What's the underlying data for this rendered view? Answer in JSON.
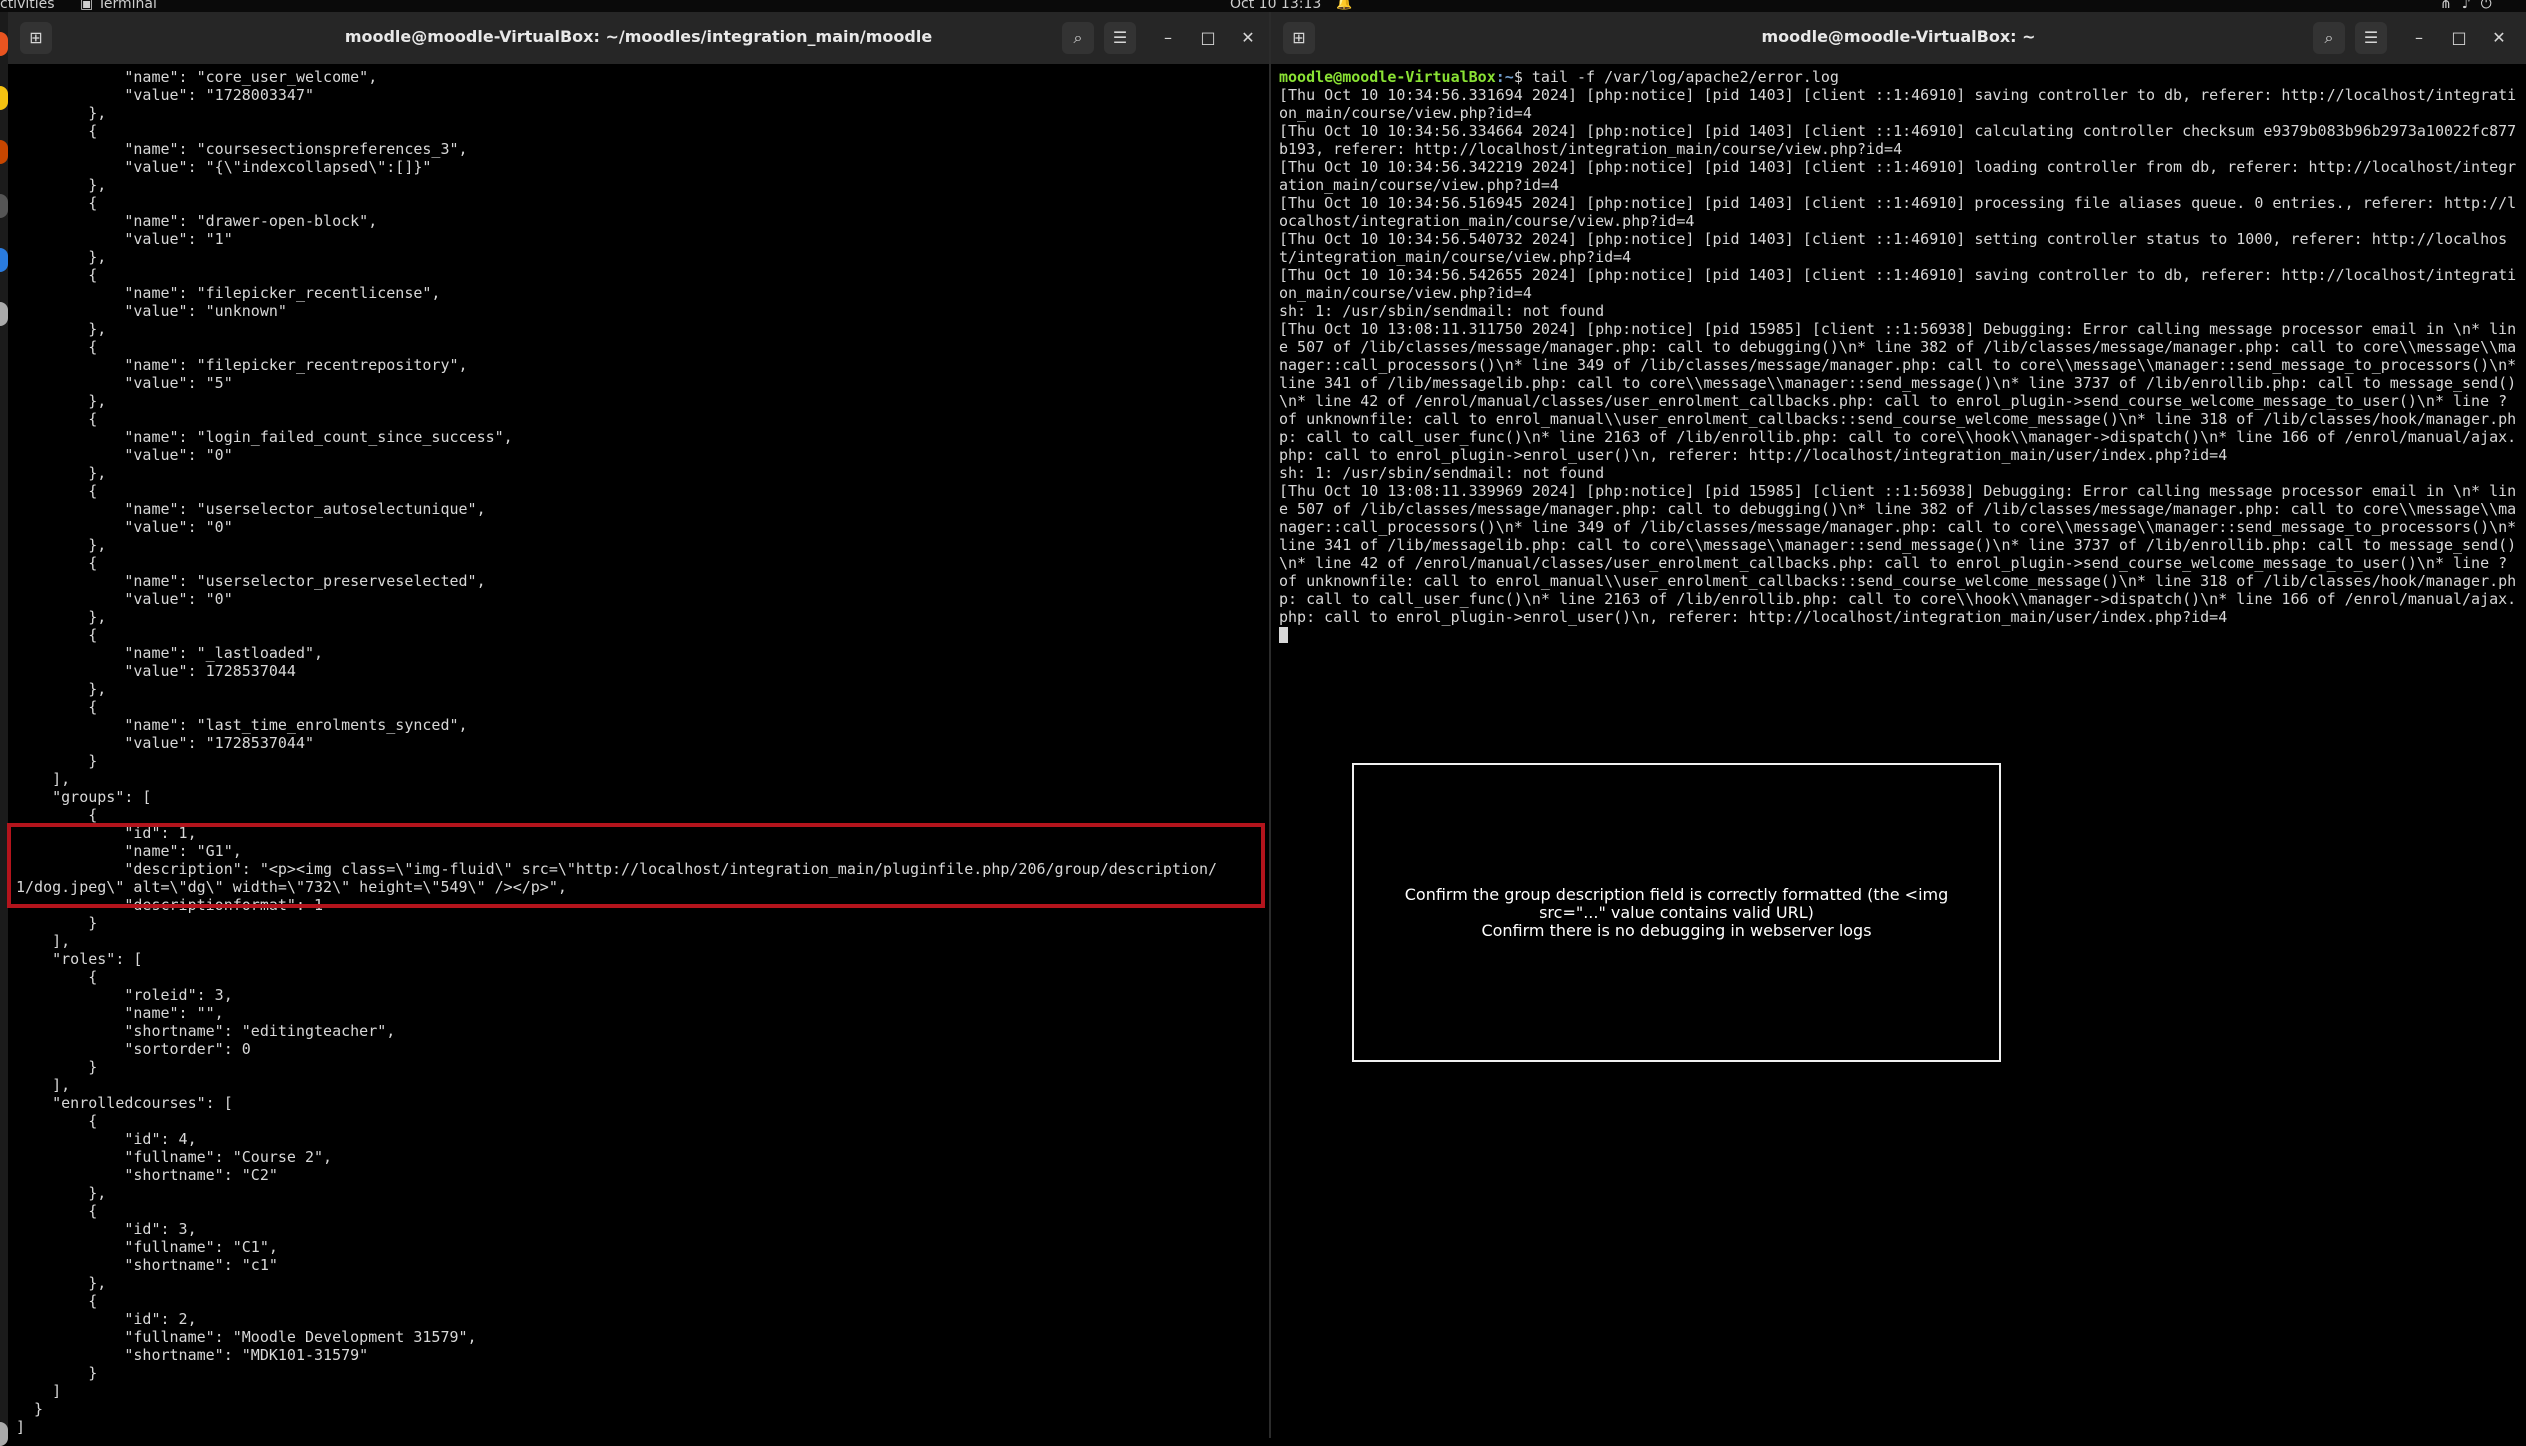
{
  "topbar": {
    "activities": "ctivities",
    "app_name": "Terminal",
    "clock": "Oct 10  13:13",
    "bell_icon": "bell-icon",
    "tray_icons": [
      "network-icon",
      "volume-icon",
      "power-icon"
    ]
  },
  "left_terminal": {
    "title": "moodle@moodle-VirtualBox: ~/moodles/integration_main/moodle",
    "lines": [
      "            \"name\": \"core_user_welcome\",",
      "            \"value\": \"1728003347\"",
      "        },",
      "        {",
      "            \"name\": \"coursesectionspreferences_3\",",
      "            \"value\": \"{\\\"indexcollapsed\\\":[]}\"",
      "        },",
      "        {",
      "            \"name\": \"drawer-open-block\",",
      "            \"value\": \"1\"",
      "        },",
      "        {",
      "            \"name\": \"filepicker_recentlicense\",",
      "            \"value\": \"unknown\"",
      "        },",
      "        {",
      "            \"name\": \"filepicker_recentrepository\",",
      "            \"value\": \"5\"",
      "        },",
      "        {",
      "            \"name\": \"login_failed_count_since_success\",",
      "            \"value\": \"0\"",
      "        },",
      "        {",
      "            \"name\": \"userselector_autoselectunique\",",
      "            \"value\": \"0\"",
      "        },",
      "        {",
      "            \"name\": \"userselector_preserveselected\",",
      "            \"value\": \"0\"",
      "        },",
      "        {",
      "            \"name\": \"_lastloaded\",",
      "            \"value\": 1728537044",
      "        },",
      "        {",
      "            \"name\": \"last_time_enrolments_synced\",",
      "            \"value\": \"1728537044\"",
      "        }",
      "    ],",
      "    \"groups\": [",
      "        {",
      "            \"id\": 1,",
      "            \"name\": \"G1\",",
      "            \"description\": \"<p><img class=\\\"img-fluid\\\" src=\\\"http://localhost/integration_main/pluginfile.php/206/group/description/",
      "1/dog.jpeg\\\" alt=\\\"dg\\\" width=\\\"732\\\" height=\\\"549\\\" /></p>\",",
      "            \"descriptionformat\": 1",
      "        }",
      "    ],",
      "    \"roles\": [",
      "        {",
      "            \"roleid\": 3,",
      "            \"name\": \"\",",
      "            \"shortname\": \"editingteacher\",",
      "            \"sortorder\": 0",
      "        }",
      "    ],",
      "    \"enrolledcourses\": [",
      "        {",
      "            \"id\": 4,",
      "            \"fullname\": \"Course 2\",",
      "            \"shortname\": \"C2\"",
      "        },",
      "        {",
      "            \"id\": 3,",
      "            \"fullname\": \"C1\",",
      "            \"shortname\": \"c1\"",
      "        },",
      "        {",
      "            \"id\": 2,",
      "            \"fullname\": \"Moodle Development 31579\",",
      "            \"shortname\": \"MDK101-31579\"",
      "        }",
      "    ]",
      "  }",
      "]"
    ],
    "highlight_label": "highlighted group description"
  },
  "right_terminal": {
    "title": "moodle@moodle-VirtualBox: ~",
    "prompt_user": "moodle@moodle-VirtualBox",
    "prompt_path": ":~",
    "prompt_symbol": "$",
    "command": " tail -f /var/log/apache2/error.log",
    "log_lines": [
      "[Thu Oct 10 10:34:56.331694 2024] [php:notice] [pid 1403] [client ::1:46910] saving controller to db, referer: http://localhost/integration_main/course/view.php?id=4",
      "[Thu Oct 10 10:34:56.334664 2024] [php:notice] [pid 1403] [client ::1:46910] calculating controller checksum e9379b083b96b2973a10022fc877b193, referer: http://localhost/integration_main/course/view.php?id=4",
      "[Thu Oct 10 10:34:56.342219 2024] [php:notice] [pid 1403] [client ::1:46910] loading controller from db, referer: http://localhost/integration_main/course/view.php?id=4",
      "[Thu Oct 10 10:34:56.516945 2024] [php:notice] [pid 1403] [client ::1:46910] processing file aliases queue. 0 entries., referer: http://localhost/integration_main/course/view.php?id=4",
      "[Thu Oct 10 10:34:56.540732 2024] [php:notice] [pid 1403] [client ::1:46910] setting controller status to 1000, referer: http://localhost/integration_main/course/view.php?id=4",
      "[Thu Oct 10 10:34:56.542655 2024] [php:notice] [pid 1403] [client ::1:46910] saving controller to db, referer: http://localhost/integration_main/course/view.php?id=4",
      "sh: 1: /usr/sbin/sendmail: not found",
      "[Thu Oct 10 13:08:11.311750 2024] [php:notice] [pid 15985] [client ::1:56938] Debugging: Error calling message processor email in \\n* line 507 of /lib/classes/message/manager.php: call to debugging()\\n* line 382 of /lib/classes/message/manager.php: call to core\\\\message\\\\manager::call_processors()\\n* line 349 of /lib/classes/message/manager.php: call to core\\\\message\\\\manager::send_message_to_processors()\\n* line 341 of /lib/messagelib.php: call to core\\\\message\\\\manager::send_message()\\n* line 3737 of /lib/enrollib.php: call to message_send()\\n* line 42 of /enrol/manual/classes/user_enrolment_callbacks.php: call to enrol_plugin->send_course_welcome_message_to_user()\\n* line ? of unknownfile: call to enrol_manual\\\\user_enrolment_callbacks::send_course_welcome_message()\\n* line 318 of /lib/classes/hook/manager.php: call to call_user_func()\\n* line 2163 of /lib/enrollib.php: call to core\\\\hook\\\\manager->dispatch()\\n* line 166 of /enrol/manual/ajax.php: call to enrol_plugin->enrol_user()\\n, referer: http://localhost/integration_main/user/index.php?id=4",
      "sh: 1: /usr/sbin/sendmail: not found",
      "[Thu Oct 10 13:08:11.339969 2024] [php:notice] [pid 15985] [client ::1:56938] Debugging: Error calling message processor email in \\n* line 507 of /lib/classes/message/manager.php: call to debugging()\\n* line 382 of /lib/classes/message/manager.php: call to core\\\\message\\\\manager::call_processors()\\n* line 349 of /lib/classes/message/manager.php: call to core\\\\message\\\\manager::send_message_to_processors()\\n* line 341 of /lib/messagelib.php: call to core\\\\message\\\\manager::send_message()\\n* line 3737 of /lib/enrollib.php: call to message_send()\\n* line 42 of /enrol/manual/classes/user_enrolment_callbacks.php: call to enrol_plugin->send_course_welcome_message_to_user()\\n* line ? of unknownfile: call to enrol_manual\\\\user_enrolment_callbacks::send_course_welcome_message()\\n* line 318 of /lib/classes/hook/manager.php: call to call_user_func()\\n* line 2163 of /lib/enrollib.php: call to core\\\\hook\\\\manager->dispatch()\\n* line 166 of /enrol/manual/ajax.php: call to enrol_plugin->enrol_user()\\n, referer: http://localhost/integration_main/user/index.php?id=4"
    ]
  },
  "note": {
    "line1": "Confirm the group description field is correctly formatted (the <img src=\"...\" value contains valid URL)",
    "line2": "Confirm there is no debugging in webserver logs"
  },
  "colors": {
    "prompt_green": "#8ae234",
    "path_blue": "#729fcf",
    "highlight_red": "#b3141c"
  }
}
